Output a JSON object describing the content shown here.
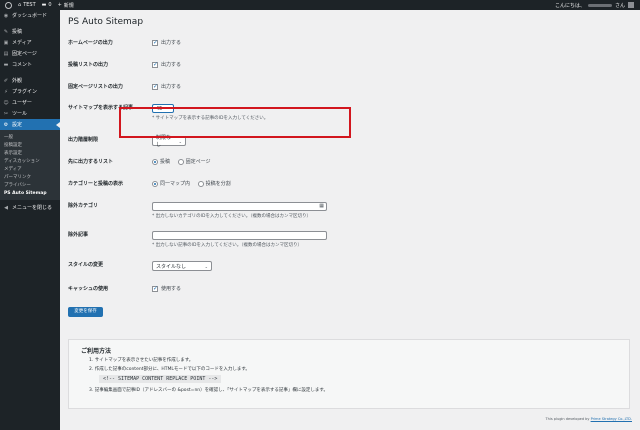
{
  "adminbar": {
    "site_name": "TEST",
    "comments_count": "0",
    "new_label": "新規",
    "greeting": "こんにちは、",
    "greeting_suffix": "さん"
  },
  "sidebar": {
    "items": [
      {
        "label": "ダッシュボード",
        "icon": "dashboard-icon",
        "glyph": "◉"
      },
      {
        "label": "投稿",
        "icon": "pin-icon",
        "glyph": "✎"
      },
      {
        "label": "メディア",
        "icon": "media-icon",
        "glyph": "▣"
      },
      {
        "label": "固定ページ",
        "icon": "page-icon",
        "glyph": "▤"
      },
      {
        "label": "コメント",
        "icon": "comment-icon",
        "glyph": "▬"
      },
      {
        "label": "外観",
        "icon": "brush-icon",
        "glyph": "✐"
      },
      {
        "label": "プラグイン",
        "icon": "plugin-icon",
        "glyph": "⚡"
      },
      {
        "label": "ユーザー",
        "icon": "user-icon",
        "glyph": "☺"
      },
      {
        "label": "ツール",
        "icon": "wrench-icon",
        "glyph": "✂"
      },
      {
        "label": "設定",
        "icon": "settings-icon",
        "glyph": "⚙"
      }
    ],
    "submenu": [
      "一般",
      "投稿設定",
      "表示設定",
      "ディスカッション",
      "メディア",
      "パーマリンク",
      "プライバシー",
      "PS Auto Sitemap"
    ],
    "collapse_label": "メニューを閉じる"
  },
  "page": {
    "title": "PS Auto Sitemap"
  },
  "form": {
    "home_output": {
      "label": "ホームページの出力",
      "option": "出力する",
      "checked": true
    },
    "post_list_output": {
      "label": "投稿リストの出力",
      "option": "出力する",
      "checked": true
    },
    "page_list_output": {
      "label": "固定ページリストの出力",
      "option": "出力する",
      "checked": true
    },
    "sitemap_post": {
      "label": "サイトマップを表示する記事",
      "value": "45",
      "description": "* サイトマップを表示する記事のIDを入力してください。"
    },
    "depth_limit": {
      "label": "出力階層制限",
      "value": "制限なし"
    },
    "first_list": {
      "label": "先に出力するリスト",
      "options": [
        "投稿",
        "固定ページ"
      ],
      "selected": 0
    },
    "category_display": {
      "label": "カテゴリーと投稿の表示",
      "options": [
        "同一マップ内",
        "投稿を分割"
      ],
      "selected": 0
    },
    "exclude_category": {
      "label": "除外カテゴリ",
      "value": "",
      "description": "* 出力しないカテゴリのIDを入力してください。（複数の場合はカンマ区切り）"
    },
    "exclude_post": {
      "label": "除外記事",
      "value": "",
      "description": "* 出力しない記事のIDを入力してください。（複数の場合はカンマ区切り）"
    },
    "style_change": {
      "label": "スタイルの変更",
      "value": "スタイルなし"
    },
    "use_cache": {
      "label": "キャッシュの使用",
      "option": "使用する",
      "checked": true
    },
    "save_label": "変更を保存"
  },
  "usage": {
    "title": "ご利用方法",
    "step1": "1. サイトマップを表示させたい記事を作成します。",
    "step2": "2. 作成した記事のcontent部分に、HTMLモードで以下のコードを入力します。",
    "code": "<!-- SITEMAP CONTENT REPLACE POINT -->",
    "step3": "3. 記事編集画面で記事ID（アドレスバーの &post=nn）を確認し、「サイトマップを表示する記事」欄に設定します。"
  },
  "footer": {
    "credit_prefix": "This plugin developed by",
    "credit_link": "Prime Strategy Co.,LTD."
  },
  "colors": {
    "accent": "#2271b1",
    "highlight": "#d2161e",
    "sidebar_bg": "#1d2327"
  }
}
